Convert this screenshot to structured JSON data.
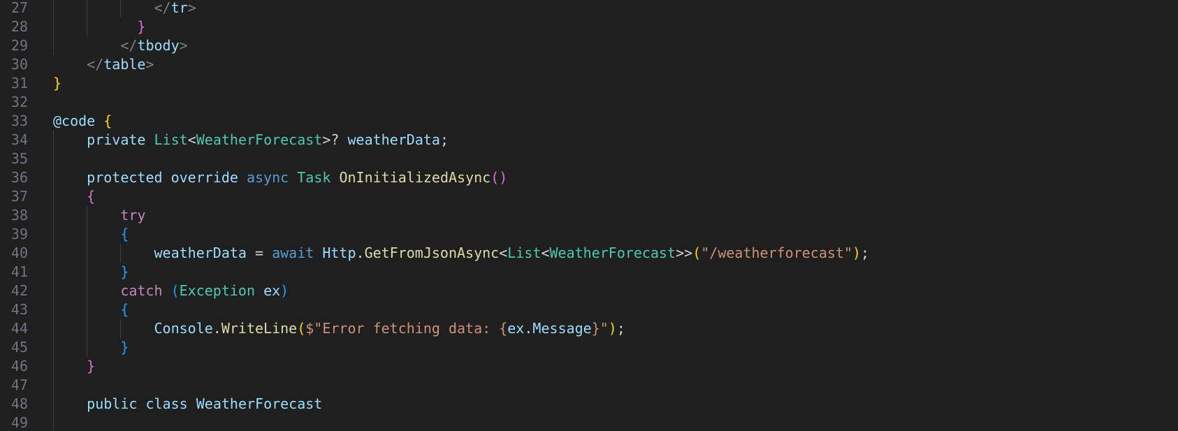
{
  "editor": {
    "colors": {
      "background": "#1f1f1f",
      "line_number": "#6e7681",
      "indent_guide": "#404040",
      "plain": "#d4d4d4",
      "variable": "#9cdcfe",
      "type": "#4ec9b0",
      "keyword": "#569cd6",
      "control": "#c586c0",
      "method": "#dcdcaa",
      "string": "#ce9178",
      "bracket_level_1": "#ffd700",
      "bracket_level_2": "#da70d6",
      "bracket_level_3": "#179fff"
    },
    "lines": [
      {
        "num": "27",
        "guides": 3,
        "tokens": [
          [
            "            ",
            "t-plain"
          ],
          [
            "</",
            "t-tag"
          ],
          [
            "tr",
            "t-var"
          ],
          [
            ">",
            "t-tag"
          ]
        ]
      },
      {
        "num": "28",
        "guides": 2,
        "tokens": [
          [
            "          ",
            "t-plain"
          ],
          [
            "}",
            "t-b2"
          ]
        ]
      },
      {
        "num": "29",
        "guides": 1,
        "tokens": [
          [
            "        ",
            "t-plain"
          ],
          [
            "</",
            "t-tag"
          ],
          [
            "tbody",
            "t-var"
          ],
          [
            ">",
            "t-tag"
          ]
        ]
      },
      {
        "num": "30",
        "guides": 0,
        "tokens": [
          [
            "    ",
            "t-plain"
          ],
          [
            "</",
            "t-tag"
          ],
          [
            "table",
            "t-var"
          ],
          [
            ">",
            "t-tag"
          ]
        ]
      },
      {
        "num": "31",
        "guides": 0,
        "tokens": [
          [
            "}",
            "t-b1"
          ]
        ]
      },
      {
        "num": "32",
        "guides": 0,
        "tokens": []
      },
      {
        "num": "33",
        "guides": 0,
        "tokens": [
          [
            "@code",
            "t-var"
          ],
          [
            " ",
            "t-plain"
          ],
          [
            "{",
            "t-b1"
          ]
        ]
      },
      {
        "num": "34",
        "guides": 1,
        "tokens": [
          [
            "    ",
            "t-plain"
          ],
          [
            "private",
            "t-var"
          ],
          [
            " ",
            "t-plain"
          ],
          [
            "List",
            "t-type"
          ],
          [
            "<",
            "t-plain"
          ],
          [
            "WeatherForecast",
            "t-type"
          ],
          [
            ">? ",
            "t-plain"
          ],
          [
            "weatherData",
            "t-var"
          ],
          [
            ";",
            "t-plain"
          ]
        ]
      },
      {
        "num": "35",
        "guides": 1,
        "tokens": []
      },
      {
        "num": "36",
        "guides": 1,
        "tokens": [
          [
            "    ",
            "t-plain"
          ],
          [
            "protected",
            "t-var"
          ],
          [
            " ",
            "t-plain"
          ],
          [
            "override",
            "t-var"
          ],
          [
            " ",
            "t-plain"
          ],
          [
            "async",
            "t-kw"
          ],
          [
            " ",
            "t-plain"
          ],
          [
            "Task",
            "t-type"
          ],
          [
            " ",
            "t-plain"
          ],
          [
            "OnInitializedAsync",
            "t-method"
          ],
          [
            "()",
            "t-b2"
          ]
        ]
      },
      {
        "num": "37",
        "guides": 1,
        "tokens": [
          [
            "    ",
            "t-plain"
          ],
          [
            "{",
            "t-b2"
          ]
        ]
      },
      {
        "num": "38",
        "guides": 2,
        "tokens": [
          [
            "        ",
            "t-plain"
          ],
          [
            "try",
            "t-ctrl"
          ]
        ]
      },
      {
        "num": "39",
        "guides": 2,
        "tokens": [
          [
            "        ",
            "t-plain"
          ],
          [
            "{",
            "t-b3"
          ]
        ]
      },
      {
        "num": "40",
        "guides": 3,
        "tokens": [
          [
            "            ",
            "t-plain"
          ],
          [
            "weatherData",
            "t-var"
          ],
          [
            " = ",
            "t-plain"
          ],
          [
            "await",
            "t-kw"
          ],
          [
            " ",
            "t-plain"
          ],
          [
            "Http",
            "t-var"
          ],
          [
            ".",
            "t-plain"
          ],
          [
            "GetFromJsonAsync",
            "t-method"
          ],
          [
            "<",
            "t-plain"
          ],
          [
            "List",
            "t-type"
          ],
          [
            "<",
            "t-plain"
          ],
          [
            "WeatherForecast",
            "t-type"
          ],
          [
            ">>",
            "t-plain"
          ],
          [
            "(",
            "t-b1"
          ],
          [
            "\"/weatherforecast\"",
            "t-str"
          ],
          [
            ")",
            "t-b1"
          ],
          [
            ";",
            "t-plain"
          ]
        ]
      },
      {
        "num": "41",
        "guides": 2,
        "tokens": [
          [
            "        ",
            "t-plain"
          ],
          [
            "}",
            "t-b3"
          ]
        ]
      },
      {
        "num": "42",
        "guides": 2,
        "tokens": [
          [
            "        ",
            "t-plain"
          ],
          [
            "catch",
            "t-ctrl"
          ],
          [
            " ",
            "t-plain"
          ],
          [
            "(",
            "t-b3"
          ],
          [
            "Exception",
            "t-type"
          ],
          [
            " ",
            "t-plain"
          ],
          [
            "ex",
            "t-var"
          ],
          [
            ")",
            "t-b3"
          ]
        ]
      },
      {
        "num": "43",
        "guides": 2,
        "tokens": [
          [
            "        ",
            "t-plain"
          ],
          [
            "{",
            "t-b3"
          ]
        ]
      },
      {
        "num": "44",
        "guides": 3,
        "tokens": [
          [
            "            ",
            "t-plain"
          ],
          [
            "Console",
            "t-var"
          ],
          [
            ".",
            "t-plain"
          ],
          [
            "WriteLine",
            "t-method"
          ],
          [
            "(",
            "t-b1"
          ],
          [
            "$\"Error fetching data: ",
            "t-str"
          ],
          [
            "{",
            "t-str"
          ],
          [
            "ex",
            "t-var"
          ],
          [
            ".",
            "t-plain"
          ],
          [
            "Message",
            "t-var"
          ],
          [
            "}\"",
            "t-str"
          ],
          [
            ")",
            "t-b1"
          ],
          [
            ";",
            "t-plain"
          ]
        ]
      },
      {
        "num": "45",
        "guides": 2,
        "tokens": [
          [
            "        ",
            "t-plain"
          ],
          [
            "}",
            "t-b3"
          ]
        ]
      },
      {
        "num": "46",
        "guides": 1,
        "tokens": [
          [
            "    ",
            "t-plain"
          ],
          [
            "}",
            "t-b2"
          ]
        ]
      },
      {
        "num": "47",
        "guides": 1,
        "tokens": []
      },
      {
        "num": "48",
        "guides": 1,
        "tokens": [
          [
            "    ",
            "t-plain"
          ],
          [
            "public",
            "t-var"
          ],
          [
            " ",
            "t-plain"
          ],
          [
            "class",
            "t-var"
          ],
          [
            " ",
            "t-plain"
          ],
          [
            "WeatherForecast",
            "t-var"
          ]
        ]
      },
      {
        "num": "49",
        "guides": 1,
        "tokens": []
      }
    ]
  }
}
